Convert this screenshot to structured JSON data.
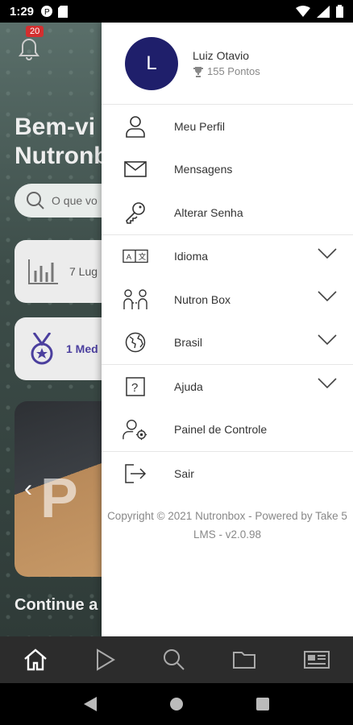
{
  "status_bar": {
    "time": "1:29"
  },
  "background": {
    "notification_count": "20",
    "welcome_text": "Bem-vi\nNutronb",
    "search_placeholder": "O que vo",
    "card1_text": "7 Lug",
    "card2_text": "1 Med",
    "banner_text": "P",
    "continue_text": "Continue a"
  },
  "drawer": {
    "avatar_initial": "L",
    "user_name": "Luiz Otavio",
    "points": "155 Pontos",
    "menu": [
      {
        "label": "Meu Perfil",
        "icon": "user-icon"
      },
      {
        "label": "Mensagens",
        "icon": "mail-icon"
      },
      {
        "label": "Alterar Senha",
        "icon": "key-icon"
      },
      {
        "label": "Idioma",
        "icon": "language-icon"
      },
      {
        "label": "Nutron Box",
        "icon": "people-icon"
      },
      {
        "label": "Brasil",
        "icon": "globe-icon"
      },
      {
        "label": "Ajuda",
        "icon": "help-icon"
      },
      {
        "label": "Painel de Controle",
        "icon": "admin-icon"
      },
      {
        "label": "Sair",
        "icon": "logout-icon"
      }
    ],
    "copyright": "Copyright © 2021 Nutronbox - Powered by Take 5 LMS - v2.0.98"
  },
  "bottom_nav": [
    "home-icon",
    "play-icon",
    "search-icon",
    "folder-icon",
    "news-icon"
  ],
  "colors": {
    "avatar_bg": "#1f1f6b",
    "accent_purple": "#4b3f9e",
    "badge_red": "#d32f2f"
  }
}
